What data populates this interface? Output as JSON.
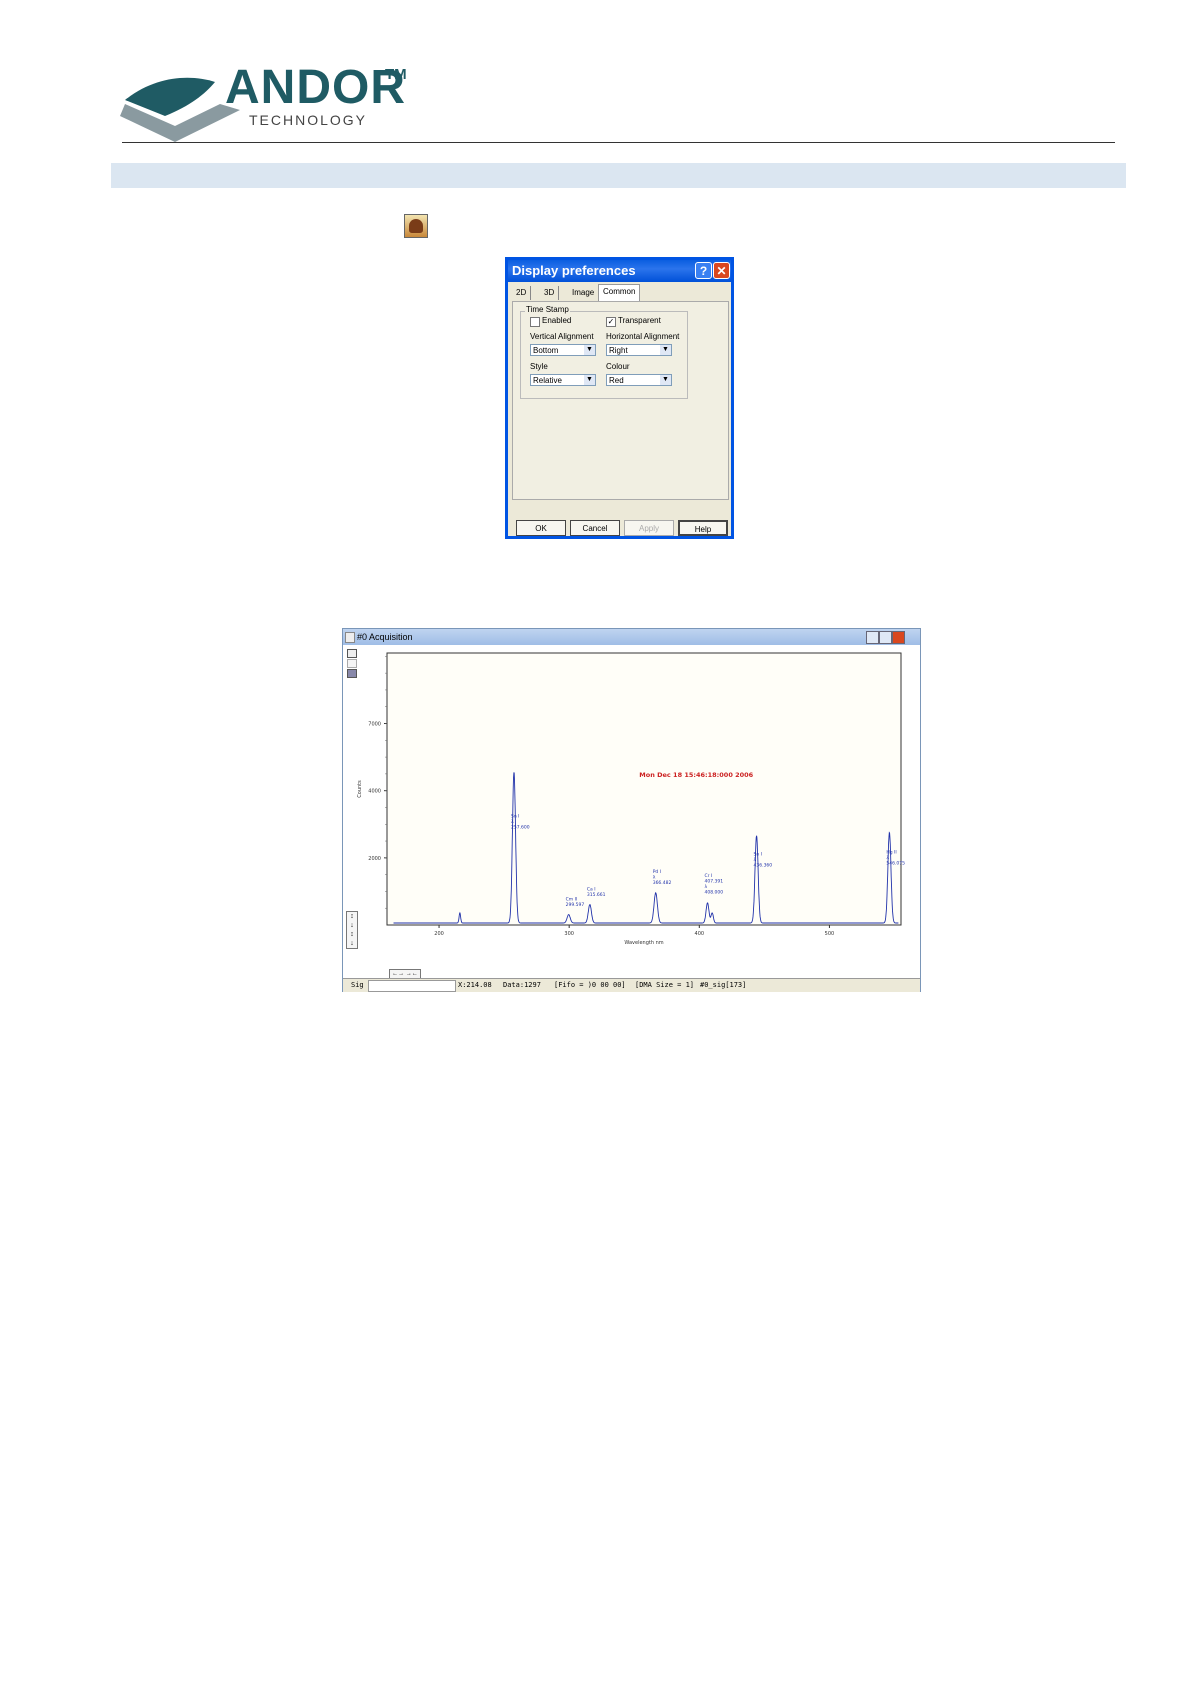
{
  "logo": {
    "name": "ANDOR",
    "trademark": "TM",
    "subtitle": "TECHNOLOGY"
  },
  "dialog": {
    "title": "Display preferences",
    "help_glyph": "?",
    "close_glyph": "✕",
    "tabs": [
      "2D",
      "3D",
      "Image",
      "Common"
    ],
    "active_tab": "Common",
    "time_stamp_label": "Time Stamp",
    "enabled_label": "Enabled",
    "enabled_checked": false,
    "transparent_label": "Transparent",
    "transparent_checked": true,
    "vertical_alignment_label": "Vertical Alignment",
    "vertical_alignment_value": "Bottom",
    "horizontal_alignment_label": "Horizontal Alignment",
    "horizontal_alignment_value": "Right",
    "style_label": "Style",
    "style_value": "Relative",
    "colour_label": "Colour",
    "colour_value": "Red",
    "buttons": {
      "ok": "OK",
      "cancel": "Cancel",
      "apply": "Apply",
      "help": "Help"
    }
  },
  "acquisition": {
    "title": "#0  Acquisition",
    "status": {
      "sig": "Sig",
      "x": "X:214.08",
      "data": "Data:1297",
      "fifo": "[Fifo = )0 00 00]",
      "dma": "[DMA Size = 1]",
      "sig_id": "#0_sig[173]"
    },
    "timestamp_overlay": "Mon Dec 18 15:46:18:000 2006",
    "timestamp_color": "#cc2222",
    "line_color": "#2233aa"
  },
  "chart_data": {
    "type": "line",
    "xlabel": "Wavelength nm",
    "ylabel": "Counts",
    "xlim": [
      160,
      555
    ],
    "ylim": [
      0,
      8100
    ],
    "x_ticks": [
      200,
      300,
      400,
      500
    ],
    "y_ticks": [
      2000,
      4000,
      6000
    ],
    "x_tick_labels": [
      "200",
      "300",
      "400",
      "500"
    ],
    "y_tick_labels": [
      "2000",
      "4000",
      "7000"
    ],
    "baseline": 60,
    "peaks": [
      {
        "x": 216,
        "y": 300,
        "width": 0.6
      },
      {
        "x": 257.6,
        "y": 4500,
        "width": 1.2
      },
      {
        "x": 299.6,
        "y": 250,
        "width": 1.2
      },
      {
        "x": 315.9,
        "y": 550,
        "width": 1.2
      },
      {
        "x": 366.5,
        "y": 900,
        "width": 1.3
      },
      {
        "x": 406.3,
        "y": 600,
        "width": 1.1
      },
      {
        "x": 409.9,
        "y": 300,
        "width": 0.9
      },
      {
        "x": 444,
        "y": 2600,
        "width": 1.2
      },
      {
        "x": 546.1,
        "y": 2700,
        "width": 1.2
      }
    ],
    "annotations": [
      {
        "x": 257.6,
        "lines": [
          "Sn I",
          "λ",
          "257.600"
        ]
      },
      {
        "x": 299.6,
        "lines": [
          "Cm II",
          "299.597"
        ]
      },
      {
        "x": 315.9,
        "lines": [
          "Ca I",
          "315.661"
        ]
      },
      {
        "x": 366.5,
        "lines": [
          "Pd I",
          "λ",
          "366.482"
        ]
      },
      {
        "x": 406.3,
        "lines": [
          "Cr I",
          "407.391",
          "λ",
          "408.000"
        ]
      },
      {
        "x": 444,
        "lines": [
          "Sn I",
          "λ",
          "436.360"
        ]
      },
      {
        "x": 546.1,
        "lines": [
          "Hg II",
          "λ",
          "546.075"
        ]
      }
    ]
  }
}
